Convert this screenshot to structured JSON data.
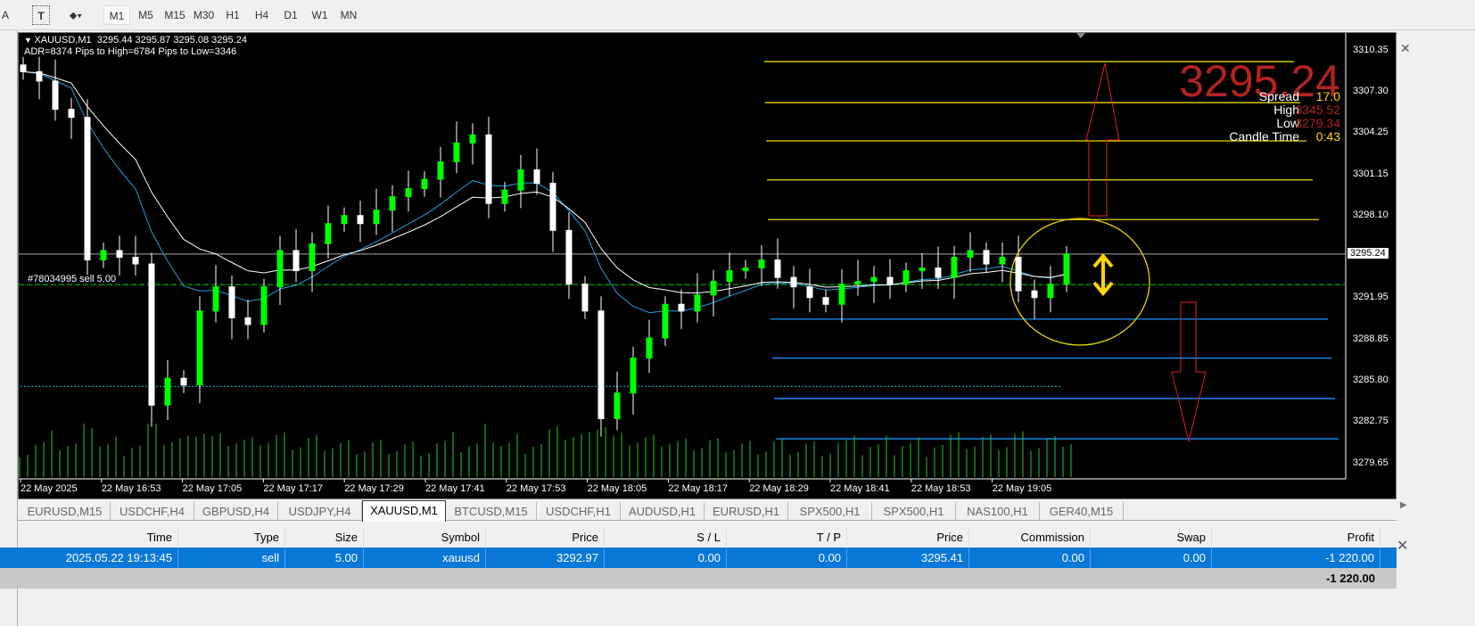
{
  "toolbar": {
    "tools": [
      "A",
      "T"
    ],
    "timeframes": [
      "M1",
      "M5",
      "M15",
      "M30",
      "H1",
      "H4",
      "D1",
      "W1",
      "MN"
    ],
    "active_timeframe": "M1"
  },
  "chart": {
    "header": "XAUUSD,M1  3295.44 3295.87 3295.08 3295.24",
    "adr_line": "ADR=8374 Pips to High=6784 Pips to Low=3346",
    "big_price": "3295.24",
    "info": [
      {
        "label": "Spread",
        "value": "17.0",
        "color": "#ffd700"
      },
      {
        "label": "High",
        "value": "3345.52",
        "color": "#b22222"
      },
      {
        "label": "Low",
        "value": "3279.34",
        "color": "#b22222"
      },
      {
        "label": "Candle Time",
        "value": "0:43",
        "color": "#ffd700"
      }
    ],
    "order_label": "#78034995 sell 5.00",
    "order_price": 3292.97,
    "current_price": 3295.24,
    "current_price_label": "3295.24",
    "price_axis": [
      "3310.35",
      "3307.30",
      "3304.25",
      "3301.15",
      "3298.10",
      "3295.24",
      "3291.95",
      "3288.85",
      "3285.80",
      "3282.75",
      "3279.65"
    ],
    "time_axis": [
      "22 May 2025",
      "22 May 16:53",
      "22 May 17:05",
      "22 May 17:17",
      "22 May 17:29",
      "22 May 17:41",
      "22 May 17:53",
      "22 May 18:05",
      "22 May 18:17",
      "22 May 18:29",
      "22 May 18:41",
      "22 May 18:53",
      "22 May 19:05"
    ],
    "yellow_levels": [
      3309.55,
      3306.5,
      3303.65,
      3300.75,
      3297.8
    ],
    "blue_levels": [
      3290.4,
      3287.5,
      3284.5,
      3281.5
    ],
    "cyan_level": 3285.4,
    "closes": [
      3308.8,
      3308.1,
      3306,
      3305.4,
      3294.8,
      3295.5,
      3295,
      3294.5,
      3284,
      3286,
      3285.5,
      3291,
      3292.8,
      3290.5,
      3290,
      3292.8,
      3295.5,
      3294,
      3296,
      3297.5,
      3298.1,
      3297.5,
      3298.5,
      3299.5,
      3300.1,
      3300.8,
      3302.1,
      3303.5,
      3304.1,
      3299,
      3300,
      3301.5,
      3300.5,
      3297,
      3293,
      3291,
      3283,
      3284.9,
      3287.5,
      3289,
      3291.5,
      3291,
      3292.2,
      3293.2,
      3294,
      3294.2,
      3294.8,
      3293.5,
      3292.8,
      3292,
      3291.5,
      3293,
      3293.2,
      3293.5,
      3293,
      3294,
      3294.2,
      3293.5,
      3295,
      3295.5,
      3294.5,
      3295,
      3292.5,
      3292,
      3293,
      3295.24
    ]
  },
  "tabs": [
    "EURUSD,M15",
    "USDCHF,H4",
    "GBPUSD,H4",
    "USDJPY,H4",
    "XAUUSD,M1",
    "BTCUSD,M15",
    "USDCHF,H1",
    "AUDUSD,H1",
    "EURUSD,H1",
    "SPX500,H1",
    "SPX500,H1",
    "NAS100,H1",
    "GER40,M15"
  ],
  "active_tab": "XAUUSD,M1",
  "trades": {
    "columns": [
      "Time",
      "Type",
      "Size",
      "Symbol",
      "Price",
      "S / L",
      "T / P",
      "Price",
      "Commission",
      "Swap",
      "Profit"
    ],
    "rows": [
      [
        "2025.05.22 19:13:45",
        "sell",
        "5.00",
        "xauusd",
        "3292.97",
        "0.00",
        "0.00",
        "3295.41",
        "0.00",
        "0.00",
        "-1 220.00"
      ]
    ],
    "total": "-1 220.00"
  }
}
